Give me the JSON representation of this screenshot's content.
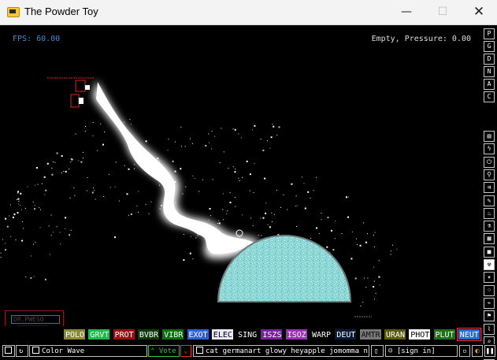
{
  "window": {
    "title": "The Powder Toy",
    "minimize": "—",
    "maximize": "☐",
    "close": "✕"
  },
  "hud": {
    "fps": "FPS: 60.00",
    "status": "Empty, Pressure: 0.00"
  },
  "sign": {
    "text": "DR.PWESO"
  },
  "right_menu": [
    {
      "label": "P",
      "icon": "p-letter-icon"
    },
    {
      "label": "G",
      "icon": "g-letter-icon"
    },
    {
      "label": "D",
      "icon": "d-letter-icon"
    },
    {
      "label": "N",
      "icon": "n-letter-icon"
    },
    {
      "label": "A",
      "icon": "a-letter-icon"
    },
    {
      "label": "C",
      "icon": "c-letter-icon"
    },
    {
      "label": "▤",
      "icon": "walls-icon"
    },
    {
      "label": "ϟ",
      "icon": "electronics-icon"
    },
    {
      "label": "⏻",
      "icon": "powered-icon"
    },
    {
      "label": "⚲",
      "icon": "sensors-icon"
    },
    {
      "label": "⇉",
      "icon": "force-icon"
    },
    {
      "label": "✎",
      "icon": "explosives-icon"
    },
    {
      "label": "♨",
      "icon": "gases-icon"
    },
    {
      "label": "⚗",
      "icon": "liquids-icon"
    },
    {
      "label": "▦",
      "icon": "powders-icon"
    },
    {
      "label": "■",
      "icon": "solids-icon"
    },
    {
      "label": "☢",
      "icon": "radioactive-icon",
      "selected": true
    },
    {
      "label": "✦",
      "icon": "special-icon"
    },
    {
      "label": "⁘",
      "icon": "life-icon"
    },
    {
      "label": "⌁",
      "icon": "tools-icon"
    },
    {
      "label": "⚑",
      "icon": "favorites-icon"
    },
    {
      "label": "⌇",
      "icon": "decoration-icon"
    },
    {
      "label": "⌕",
      "icon": "search-icon"
    },
    {
      "label": "❚❚",
      "icon": "pause-icon"
    }
  ],
  "elements": [
    {
      "label": "POLO",
      "bg": "#8a8a32",
      "fg": "#ffffff"
    },
    {
      "label": "GRVT",
      "bg": "#1fb84a",
      "fg": "#ffffff"
    },
    {
      "label": "PROT",
      "bg": "#9c1010",
      "fg": "#ffffff"
    },
    {
      "label": "BVBR",
      "bg": "#0e3c0e",
      "fg": "#ffffff"
    },
    {
      "label": "VIBR",
      "bg": "#0f6f0f",
      "fg": "#ffffff"
    },
    {
      "label": "EXOT",
      "bg": "#2a62d8",
      "fg": "#ffffff"
    },
    {
      "label": "ELEC",
      "bg": "#e8e8ff",
      "fg": "#000000"
    },
    {
      "label": "SING",
      "bg": "#000000",
      "fg": "#ffffff"
    },
    {
      "label": "ISZS",
      "bg": "#7a1f9e",
      "fg": "#ffffff"
    },
    {
      "label": "ISOZ",
      "bg": "#9b2fb5",
      "fg": "#ffffff"
    },
    {
      "label": "WARP",
      "bg": "#000000",
      "fg": "#ffffff"
    },
    {
      "label": "DEUT",
      "bg": "#071a3c",
      "fg": "#ffffff"
    },
    {
      "label": "AMTR",
      "bg": "#777777",
      "fg": "#111111"
    },
    {
      "label": "URAN",
      "bg": "#5b5b0e",
      "fg": "#ffffff"
    },
    {
      "label": "PHOT",
      "bg": "#ffffff",
      "fg": "#000000"
    },
    {
      "label": "PLUT",
      "bg": "#1e6f1e",
      "fg": "#ffffff"
    },
    {
      "label": "NEUT",
      "bg": "#1f6fd1",
      "fg": "#ffffff",
      "selected": true
    }
  ],
  "bottom": {
    "save_name": "Color Wave",
    "vote": "Vote",
    "tags": "cat germanart glowy heyapple jomomma n...",
    "sign_in": "[sign in]"
  },
  "colors": {
    "accent_blue": "#3a8ed8",
    "selection_red": "#ff3030",
    "neut_blue": "#1f6fd1",
    "glass_cyan": "#8fd6d6"
  }
}
